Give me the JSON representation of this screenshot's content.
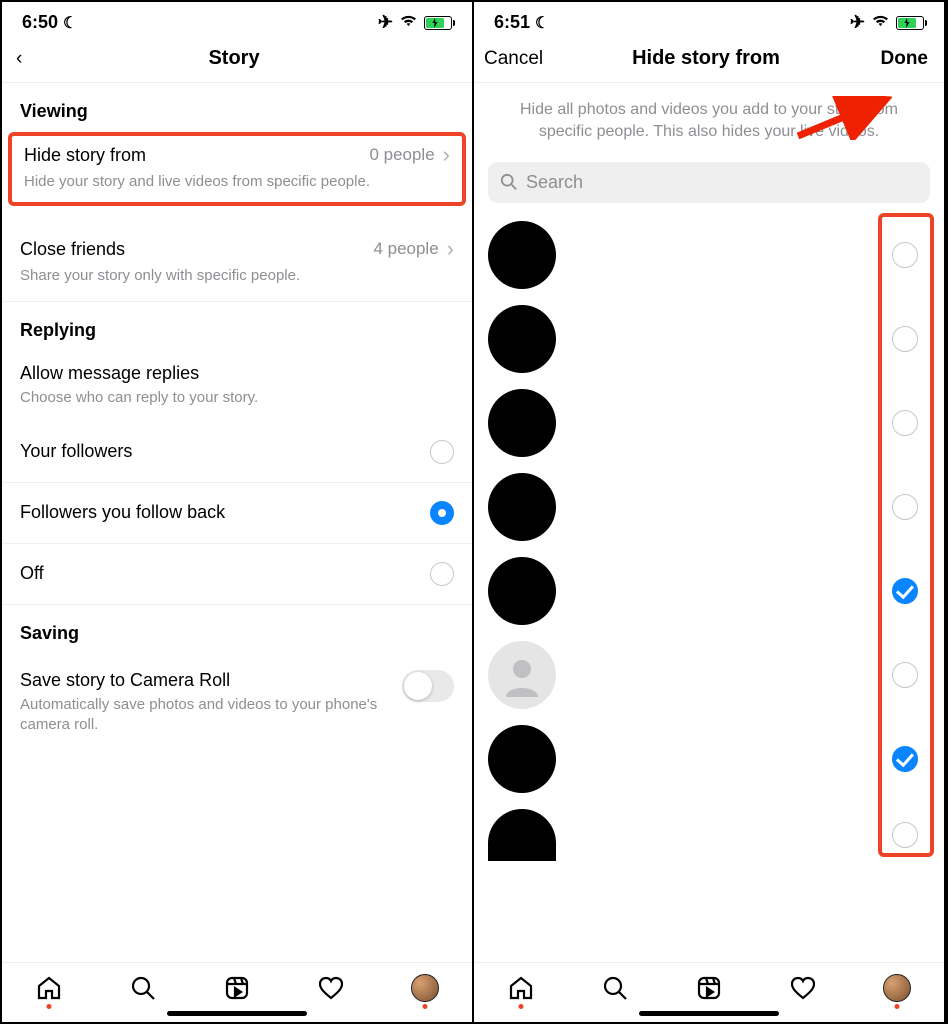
{
  "left": {
    "status_time": "6:50",
    "header_title": "Story",
    "section_viewing": "Viewing",
    "hide_story": {
      "title": "Hide story from",
      "value": "0 people",
      "sub": "Hide your story and live videos from specific people."
    },
    "close_friends": {
      "title": "Close friends",
      "value": "4 people",
      "sub": "Share your story only with specific people."
    },
    "section_replying": "Replying",
    "allow_replies": {
      "title": "Allow message replies",
      "sub": "Choose who can reply to your story."
    },
    "radio_options": {
      "opt1": "Your followers",
      "opt2": "Followers you follow back",
      "opt3": "Off",
      "selected": "opt2"
    },
    "section_saving": "Saving",
    "save_camera": {
      "title": "Save story to Camera Roll",
      "sub": "Automatically save photos and videos to your phone's camera roll."
    }
  },
  "right": {
    "status_time": "6:51",
    "header_cancel": "Cancel",
    "header_title": "Hide story from",
    "header_done": "Done",
    "description": "Hide all photos and videos you add to your story from specific people. This also hides your live videos.",
    "search_placeholder": "Search",
    "people": [
      {
        "avatar": "black",
        "checked": false
      },
      {
        "avatar": "black",
        "checked": false
      },
      {
        "avatar": "black",
        "checked": false
      },
      {
        "avatar": "black",
        "checked": false
      },
      {
        "avatar": "black",
        "checked": true
      },
      {
        "avatar": "placeholder",
        "checked": false
      },
      {
        "avatar": "black",
        "checked": true
      },
      {
        "avatar": "partial",
        "checked": false
      }
    ]
  }
}
